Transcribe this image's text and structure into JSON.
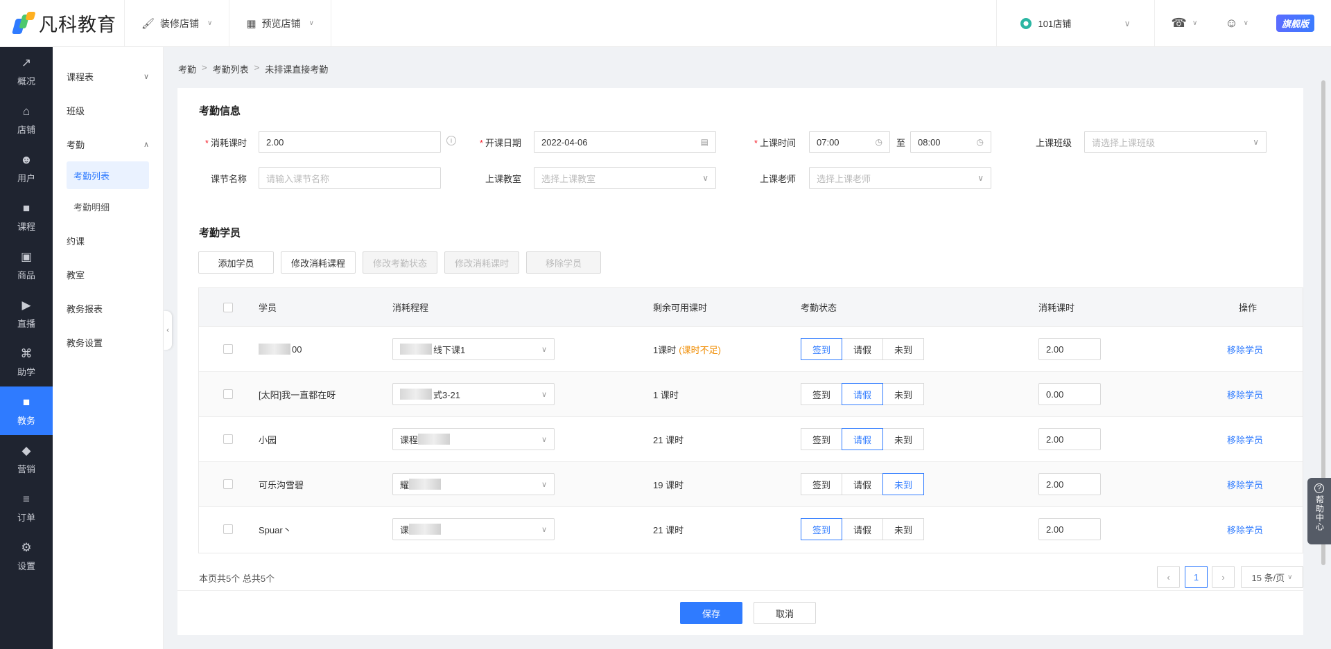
{
  "brand": {
    "name": "凡科教育"
  },
  "topnav": [
    {
      "label": "装修店铺",
      "icon": "brush-icon"
    },
    {
      "label": "预览店铺",
      "icon": "grid-icon"
    }
  ],
  "store": {
    "name": "101店铺"
  },
  "badge": {
    "label": "旗舰版"
  },
  "colors": {
    "primary": "#2f7bff",
    "sidebar": "#1f2430",
    "warning": "#f08c00",
    "required": "#f5222d"
  },
  "sidebar_main": [
    {
      "label": "概况",
      "icon": "chart-icon"
    },
    {
      "label": "店铺",
      "icon": "shop-icon"
    },
    {
      "label": "用户",
      "icon": "users-icon"
    },
    {
      "label": "课程",
      "icon": "book-icon"
    },
    {
      "label": "商品",
      "icon": "bag-icon"
    },
    {
      "label": "直播",
      "icon": "video-icon"
    },
    {
      "label": "助学",
      "icon": "gamepad-icon"
    },
    {
      "label": "教务",
      "icon": "edu-icon",
      "active": true
    },
    {
      "label": "营销",
      "icon": "tag-icon"
    },
    {
      "label": "订单",
      "icon": "order-icon"
    },
    {
      "label": "设置",
      "icon": "gear-icon"
    }
  ],
  "sidebar_sub": {
    "schedule": "课程表",
    "class": "班级",
    "attendance": "考勤",
    "attendance_list": "考勤列表",
    "attendance_detail": "考勤明细",
    "booking": "约课",
    "classroom": "教室",
    "report": "教务报表",
    "settings": "教务设置"
  },
  "breadcrumb": [
    "考勤",
    "考勤列表",
    "未排课直接考勤"
  ],
  "form": {
    "section_title": "考勤信息",
    "hours_label": "消耗课时",
    "hours_value": "2.00",
    "date_label": "开课日期",
    "date_value": "2022-04-06",
    "time_label": "上课时间",
    "time_start": "07:00",
    "time_to": "至",
    "time_end": "08:00",
    "class_label": "上课班级",
    "class_placeholder": "请选择上课班级",
    "lesson_label": "课节名称",
    "lesson_placeholder": "请输入课节名称",
    "room_label": "上课教室",
    "room_placeholder": "选择上课教室",
    "teacher_label": "上课老师",
    "teacher_placeholder": "选择上课老师"
  },
  "students": {
    "section_title": "考勤学员",
    "actions": [
      "添加学员",
      "修改消耗课程",
      "修改考勤状态",
      "修改消耗课时",
      "移除学员"
    ],
    "columns": [
      "学员",
      "消耗程程",
      "剩余可用课时",
      "考勤状态",
      "消耗课时",
      "操作"
    ],
    "status_options": [
      "签到",
      "请假",
      "未到"
    ],
    "rows": [
      {
        "name": "00",
        "course": "线下课1",
        "remaining": "1课时",
        "remaining_note": "(课时不足)",
        "status": 0,
        "hours": "2.00",
        "op": "移除学员"
      },
      {
        "name": "[太阳]我一直都在呀",
        "course": "式3-21",
        "remaining": "1 课时",
        "remaining_note": "",
        "status": 1,
        "hours": "0.00",
        "op": "移除学员"
      },
      {
        "name": "小园",
        "course": "课程",
        "remaining": "21 课时",
        "remaining_note": "",
        "status": 1,
        "hours": "2.00",
        "op": "移除学员"
      },
      {
        "name": "可乐沟雪碧",
        "course": "耀",
        "remaining": "19 课时",
        "remaining_note": "",
        "status": 2,
        "hours": "2.00",
        "op": "移除学员"
      },
      {
        "name": "Spuar丶",
        "course": "课",
        "remaining": "21 课时",
        "remaining_note": "",
        "status": 0,
        "hours": "2.00",
        "op": "移除学员"
      }
    ]
  },
  "pagination": {
    "summary": "本页共5个 总共5个",
    "current": "1",
    "page_size": "15 条/页"
  },
  "footer": {
    "save": "保存",
    "cancel": "取消"
  },
  "help": {
    "label": "帮助中心"
  }
}
